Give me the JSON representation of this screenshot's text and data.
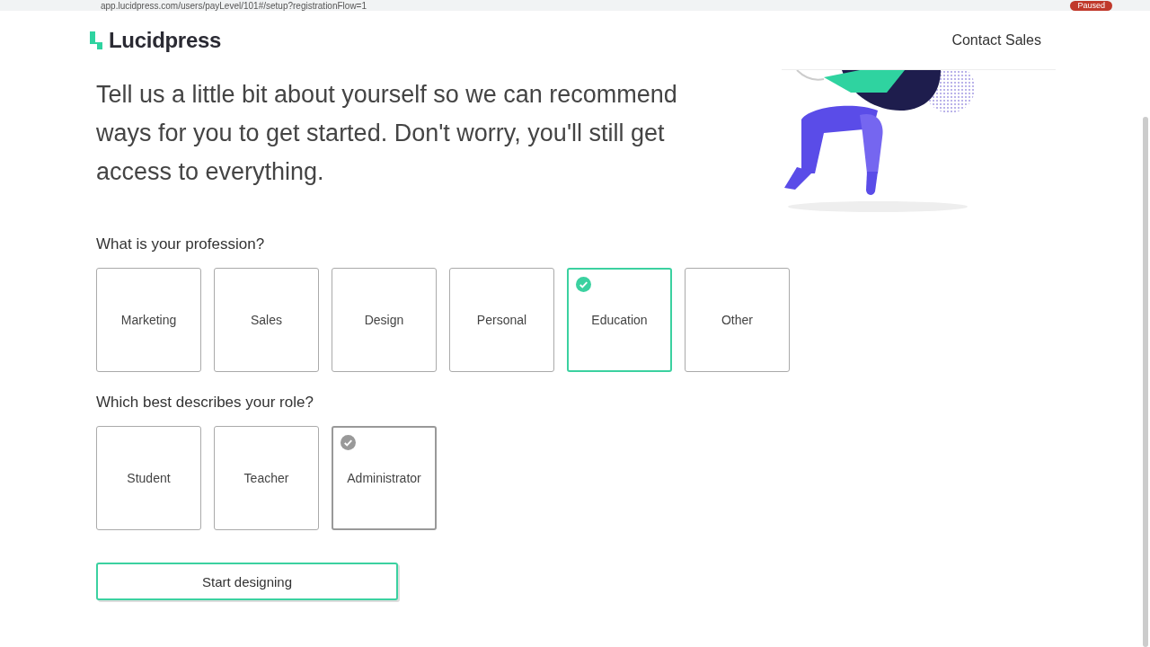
{
  "browser": {
    "url": "app.lucidpress.com/users/payLevel/101#/setup?registrationFlow=1",
    "profile_status": "Paused"
  },
  "header": {
    "logo": "Lucidpress",
    "contact": "Contact Sales"
  },
  "intro": "Tell us a little bit about yourself so we can recommend ways for you to get started. Don't worry, you'll still get access to everything.",
  "profession": {
    "question": "What is your profession?",
    "options": [
      {
        "label": "Marketing",
        "selected": false,
        "hovered": false
      },
      {
        "label": "Sales",
        "selected": false,
        "hovered": false
      },
      {
        "label": "Design",
        "selected": false,
        "hovered": false
      },
      {
        "label": "Personal",
        "selected": false,
        "hovered": false
      },
      {
        "label": "Education",
        "selected": true,
        "hovered": false
      },
      {
        "label": "Other",
        "selected": false,
        "hovered": false
      }
    ]
  },
  "role": {
    "question": "Which best describes your role?",
    "options": [
      {
        "label": "Student",
        "selected": false,
        "hovered": false
      },
      {
        "label": "Teacher",
        "selected": false,
        "hovered": false
      },
      {
        "label": "Administrator",
        "selected": false,
        "hovered": true
      }
    ]
  },
  "submit": "Start designing"
}
